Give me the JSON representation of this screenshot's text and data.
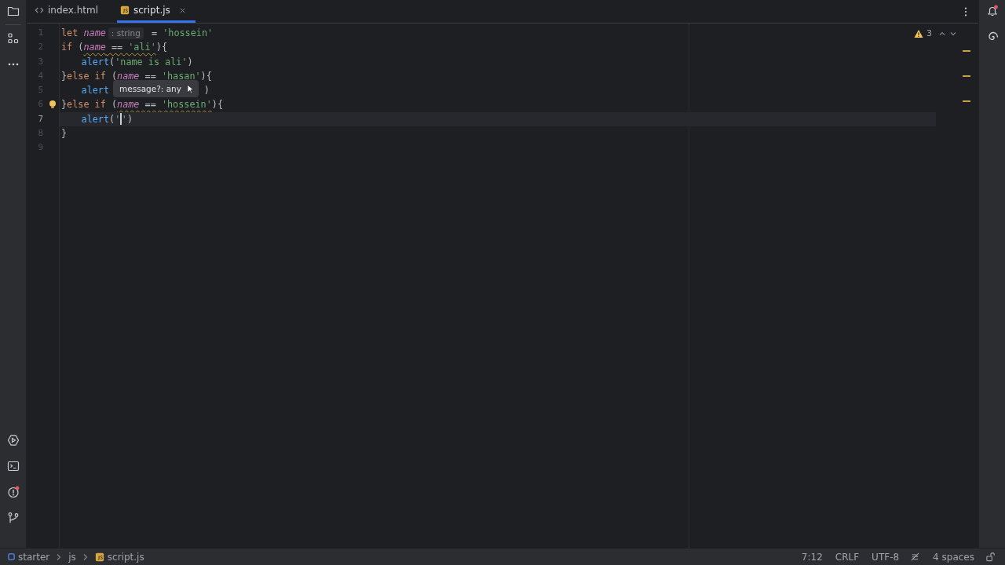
{
  "tabs": [
    {
      "label": "index.html",
      "kind": "html",
      "selected": false,
      "closable": false
    },
    {
      "label": "script.js",
      "kind": "js",
      "selected": true,
      "closable": true
    }
  ],
  "editor": {
    "warnings": "3",
    "lines": [
      {
        "number": "1",
        "current": false,
        "tokens": [
          {
            "kind": "kw",
            "text": "let "
          },
          {
            "kind": "var",
            "text": "name"
          },
          {
            "kind": "hint",
            "text": ": string"
          },
          {
            "kind": "punc",
            "text": " = "
          },
          {
            "kind": "str",
            "text": "'hossein'"
          }
        ]
      },
      {
        "number": "2",
        "current": false,
        "tokens": [
          {
            "kind": "kw",
            "text": "if "
          },
          {
            "kind": "punc",
            "text": "("
          },
          {
            "kind": "var",
            "text": "name",
            "squiggle": true
          },
          {
            "kind": "punc",
            "text": " == ",
            "squiggle": true
          },
          {
            "kind": "str",
            "text": "'ali'",
            "squiggle": true
          },
          {
            "kind": "punc",
            "text": "){"
          }
        ]
      },
      {
        "number": "3",
        "current": false,
        "tokens": [
          {
            "kind": "indent"
          },
          {
            "kind": "fn",
            "text": "alert"
          },
          {
            "kind": "punc",
            "text": "("
          },
          {
            "kind": "str",
            "text": "'name is ali'"
          },
          {
            "kind": "punc",
            "text": ")"
          }
        ]
      },
      {
        "number": "4",
        "current": false,
        "tokens": [
          {
            "kind": "punc",
            "text": "}"
          },
          {
            "kind": "kw",
            "text": "else if "
          },
          {
            "kind": "punc",
            "text": "("
          },
          {
            "kind": "var",
            "text": "name"
          },
          {
            "kind": "punc",
            "text": " == "
          },
          {
            "kind": "str",
            "text": "'hasan'"
          },
          {
            "kind": "punc",
            "text": "){"
          }
        ]
      },
      {
        "number": "5",
        "current": false,
        "tokens": [
          {
            "kind": "indent"
          },
          {
            "kind": "fn",
            "text": "alert"
          },
          {
            "kind": "covered"
          },
          {
            "kind": "punc",
            "text": ")"
          }
        ]
      },
      {
        "number": "6",
        "current": false,
        "bulb": true,
        "tokens": [
          {
            "kind": "punc",
            "text": "}"
          },
          {
            "kind": "kw",
            "text": "else if "
          },
          {
            "kind": "punc",
            "text": "("
          },
          {
            "kind": "var",
            "text": "name",
            "squiggle": true
          },
          {
            "kind": "punc",
            "text": " == ",
            "squiggle": true
          },
          {
            "kind": "str",
            "text": "'hossein'",
            "squiggle": true
          },
          {
            "kind": "punc",
            "text": "){"
          }
        ]
      },
      {
        "number": "7",
        "current": true,
        "tokens": [
          {
            "kind": "indent"
          },
          {
            "kind": "fn",
            "text": "alert"
          },
          {
            "kind": "punc",
            "text": "("
          },
          {
            "kind": "str",
            "text": "'"
          },
          {
            "kind": "caret"
          },
          {
            "kind": "str",
            "text": "'"
          },
          {
            "kind": "punc",
            "text": ")"
          }
        ]
      },
      {
        "number": "8",
        "current": false,
        "tokens": [
          {
            "kind": "punc",
            "text": "}"
          }
        ]
      },
      {
        "number": "9",
        "current": false
      }
    ],
    "tooltip": "message?: any"
  },
  "breadcrumbs": [
    {
      "label": "starter",
      "kind": "module"
    },
    {
      "label": "js",
      "kind": "folder"
    },
    {
      "label": "script.js",
      "kind": "js"
    }
  ],
  "status_bar": {
    "position": "7:12",
    "line_separator": "CRLF",
    "encoding": "UTF-8",
    "indent": "4 spaces"
  }
}
